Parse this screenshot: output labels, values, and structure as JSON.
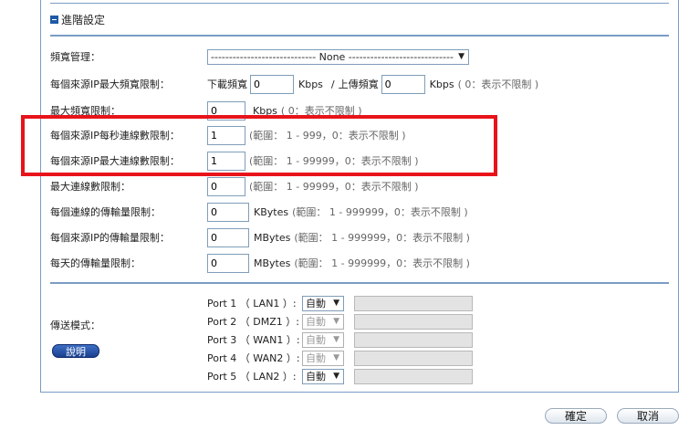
{
  "section": {
    "title": "進階設定"
  },
  "rows": {
    "bandwidth_mgmt": {
      "label": "頻寬管理：",
      "value": "----------------------------- None -----------------------------"
    },
    "per_ip_bw": {
      "label": "每個來源IP最大頻寬限制：",
      "download_label": "下載頻寬",
      "download_value": "0",
      "download_unit": "Kbps",
      "separator": "/",
      "upload_label": "上傳頻寬",
      "upload_value": "0",
      "upload_unit": "Kbps",
      "upload_hint": "( 0：表示不限制 )"
    },
    "max_bw": {
      "label": "最大頻寬限制：",
      "value": "0",
      "unit": "Kbps",
      "hint": "( 0：表示不限制 )"
    },
    "per_ip_conn_per_sec": {
      "label": "每個來源IP每秒連線數限制：",
      "value": "1",
      "hint": "(範圍： 1 - 999，0：表示不限制 )"
    },
    "per_ip_max_conn": {
      "label": "每個來源IP最大連線數限制：",
      "value": "1",
      "hint": "(範圍： 1 - 99999，0：表示不限制 )"
    },
    "max_conn": {
      "label": "最大連線數限制：",
      "value": "0",
      "hint": "(範圍： 1 - 99999，0：表示不限制 )"
    },
    "per_conn_transfer": {
      "label": "每個連線的傳輸量限制：",
      "value": "0",
      "unit": "KBytes",
      "hint": "(範圍： 1 - 999999，0：表示不限制 )"
    },
    "per_ip_transfer": {
      "label": "每個來源IP的傳輸量限制：",
      "value": "0",
      "unit": "MBytes",
      "hint": "(範圍： 1 - 999999，0：表示不限制 )"
    },
    "daily_transfer": {
      "label": "每天的傳輸量限制：",
      "value": "0",
      "unit": "MBytes",
      "hint": "(範圍： 1 - 999999，0：表示不限制 )"
    }
  },
  "transfer_mode": {
    "label": "傳送模式：",
    "help_button": "說明",
    "ports": [
      {
        "label": "Port 1 （ LAN1 ）:",
        "value": "自動",
        "enabled": true
      },
      {
        "label": "Port 2 （ DMZ1 ）:",
        "value": "自動",
        "enabled": false
      },
      {
        "label": "Port 3 （ WAN1 ）:",
        "value": "自動",
        "enabled": false
      },
      {
        "label": "Port 4 （ WAN2 ）:",
        "value": "自動",
        "enabled": false
      },
      {
        "label": "Port 5 （ LAN2 ）:",
        "value": "自動",
        "enabled": true
      }
    ]
  },
  "buttons": {
    "ok": "確定",
    "cancel": "取消"
  },
  "colors": {
    "border_blue": "#7a9cc4",
    "highlight_red": "#e8131a",
    "help_button_blue": "#1b3f8f"
  }
}
